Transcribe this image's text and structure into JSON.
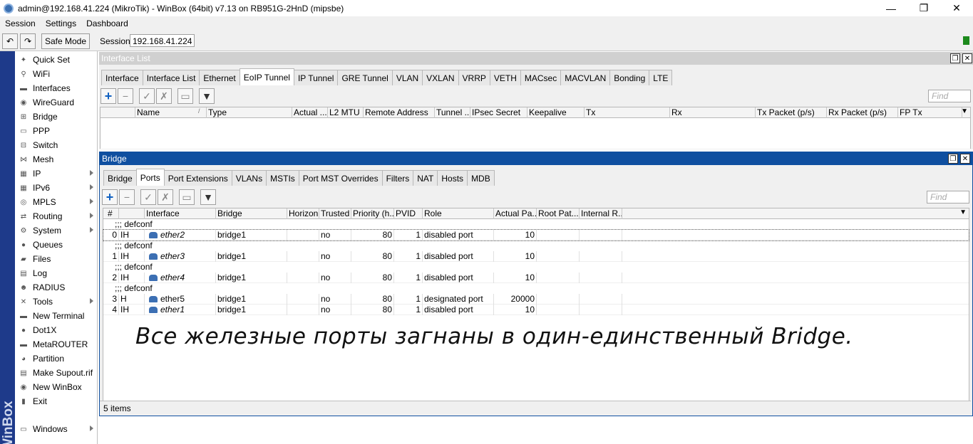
{
  "window": {
    "title": "admin@192.168.41.224 (MikroTik) - WinBox (64bit) v7.13 on RB951G-2HnD (mipsbe)",
    "minimize": "—",
    "maximize": "❐",
    "close": "✕"
  },
  "menu": [
    "Session",
    "Settings",
    "Dashboard"
  ],
  "toolbar": {
    "undo": "↶",
    "redo": "↷",
    "safe_mode": "Safe Mode",
    "session_label": "Session:",
    "session_value": "192.168.41.224"
  },
  "brand": "WinBox",
  "sidebar": [
    {
      "label": "Quick Set",
      "icon": "wand-icon",
      "glyph": "✦",
      "submenu": false
    },
    {
      "label": "WiFi",
      "icon": "wifi-icon",
      "glyph": "⚲",
      "submenu": false
    },
    {
      "label": "Interfaces",
      "icon": "interfaces-icon",
      "glyph": "▬",
      "submenu": false
    },
    {
      "label": "WireGuard",
      "icon": "wireguard-icon",
      "glyph": "◉",
      "submenu": false
    },
    {
      "label": "Bridge",
      "icon": "bridge-icon",
      "glyph": "⊞",
      "submenu": false
    },
    {
      "label": "PPP",
      "icon": "ppp-icon",
      "glyph": "▭",
      "submenu": false
    },
    {
      "label": "Switch",
      "icon": "switch-icon",
      "glyph": "⊟",
      "submenu": false
    },
    {
      "label": "Mesh",
      "icon": "mesh-icon",
      "glyph": "⋈",
      "submenu": false
    },
    {
      "label": "IP",
      "icon": "ip-icon",
      "glyph": "▦",
      "submenu": true
    },
    {
      "label": "IPv6",
      "icon": "ipv6-icon",
      "glyph": "▦",
      "submenu": true
    },
    {
      "label": "MPLS",
      "icon": "mpls-icon",
      "glyph": "◎",
      "submenu": true
    },
    {
      "label": "Routing",
      "icon": "routing-icon",
      "glyph": "⇄",
      "submenu": true
    },
    {
      "label": "System",
      "icon": "system-icon",
      "glyph": "⚙",
      "submenu": true
    },
    {
      "label": "Queues",
      "icon": "queues-icon",
      "glyph": "●",
      "submenu": false
    },
    {
      "label": "Files",
      "icon": "files-icon",
      "glyph": "▰",
      "submenu": false
    },
    {
      "label": "Log",
      "icon": "log-icon",
      "glyph": "▤",
      "submenu": false
    },
    {
      "label": "RADIUS",
      "icon": "radius-icon",
      "glyph": "☻",
      "submenu": false
    },
    {
      "label": "Tools",
      "icon": "tools-icon",
      "glyph": "✕",
      "submenu": true
    },
    {
      "label": "New Terminal",
      "icon": "terminal-icon",
      "glyph": "▬",
      "submenu": false
    },
    {
      "label": "Dot1X",
      "icon": "dot1x-icon",
      "glyph": "●",
      "submenu": false
    },
    {
      "label": "MetaROUTER",
      "icon": "metarouter-icon",
      "glyph": "▬",
      "submenu": false
    },
    {
      "label": "Partition",
      "icon": "partition-icon",
      "glyph": "◕",
      "submenu": false
    },
    {
      "label": "Make Supout.rif",
      "icon": "supout-icon",
      "glyph": "▤",
      "submenu": false
    },
    {
      "label": "New WinBox",
      "icon": "winbox-icon",
      "glyph": "◉",
      "submenu": false
    },
    {
      "label": "Exit",
      "icon": "exit-icon",
      "glyph": "▮",
      "submenu": false
    },
    {
      "label": "Windows",
      "icon": "windows-icon",
      "glyph": "▭",
      "submenu": true
    }
  ],
  "interface_list": {
    "title": "Interface List",
    "tabs": [
      "Interface",
      "Interface List",
      "Ethernet",
      "EoIP Tunnel",
      "IP Tunnel",
      "GRE Tunnel",
      "VLAN",
      "VXLAN",
      "VRRP",
      "VETH",
      "MACsec",
      "MACVLAN",
      "Bonding",
      "LTE"
    ],
    "selected_tab": "EoIP Tunnel",
    "find_placeholder": "Find",
    "columns": [
      "Name",
      "Type",
      "Actual ...",
      "L2 MTU",
      "Remote Address",
      "Tunnel ...",
      "IPsec Secret",
      "Keepalive",
      "Tx",
      "Rx",
      "Tx Packet (p/s)",
      "Rx Packet (p/s)",
      "FP Tx"
    ],
    "sort_mark": "/"
  },
  "bridge": {
    "title": "Bridge",
    "tabs": [
      "Bridge",
      "Ports",
      "Port Extensions",
      "VLANs",
      "MSTIs",
      "Port MST Overrides",
      "Filters",
      "NAT",
      "Hosts",
      "MDB"
    ],
    "selected_tab": "Ports",
    "find_placeholder": "Find",
    "columns": [
      "#",
      "",
      "Interface",
      "Bridge",
      "Horizon",
      "Trusted",
      "Priority (h...",
      "PVID",
      "Role",
      "Actual Pa...",
      "Root Pat...",
      "Internal R..."
    ],
    "rows": [
      {
        "comment": ";;; defconf",
        "num": "0",
        "flags": "IH",
        "iface": "ether2",
        "italic": true,
        "bridge": "bridge1",
        "horizon": "",
        "trusted": "no",
        "priority": "80",
        "pvid": "1",
        "role": "disabled port",
        "path_cost": "10"
      },
      {
        "comment": ";;; defconf",
        "num": "1",
        "flags": "IH",
        "iface": "ether3",
        "italic": true,
        "bridge": "bridge1",
        "horizon": "",
        "trusted": "no",
        "priority": "80",
        "pvid": "1",
        "role": "disabled port",
        "path_cost": "10"
      },
      {
        "comment": ";;; defconf",
        "num": "2",
        "flags": "IH",
        "iface": "ether4",
        "italic": true,
        "bridge": "bridge1",
        "horizon": "",
        "trusted": "no",
        "priority": "80",
        "pvid": "1",
        "role": "disabled port",
        "path_cost": "10"
      },
      {
        "comment": ";;; defconf",
        "num": "3",
        "flags": "H",
        "iface": "ether5",
        "italic": false,
        "bridge": "bridge1",
        "horizon": "",
        "trusted": "no",
        "priority": "80",
        "pvid": "1",
        "role": "designated port",
        "path_cost": "20000"
      },
      {
        "comment": "",
        "num": "4",
        "flags": "IH",
        "iface": "ether1",
        "italic": true,
        "bridge": "bridge1",
        "horizon": "",
        "trusted": "no",
        "priority": "80",
        "pvid": "1",
        "role": "disabled port",
        "path_cost": "10"
      }
    ],
    "status": "5 items"
  },
  "annotation": "Все железные порты загнаны в один-единственный Bridge.",
  "colors": {
    "brand_strip": "#1e3a8a",
    "active_title": "#0f4fa0",
    "add_button": "#1060c0",
    "status_green": "#1c8a1c"
  }
}
